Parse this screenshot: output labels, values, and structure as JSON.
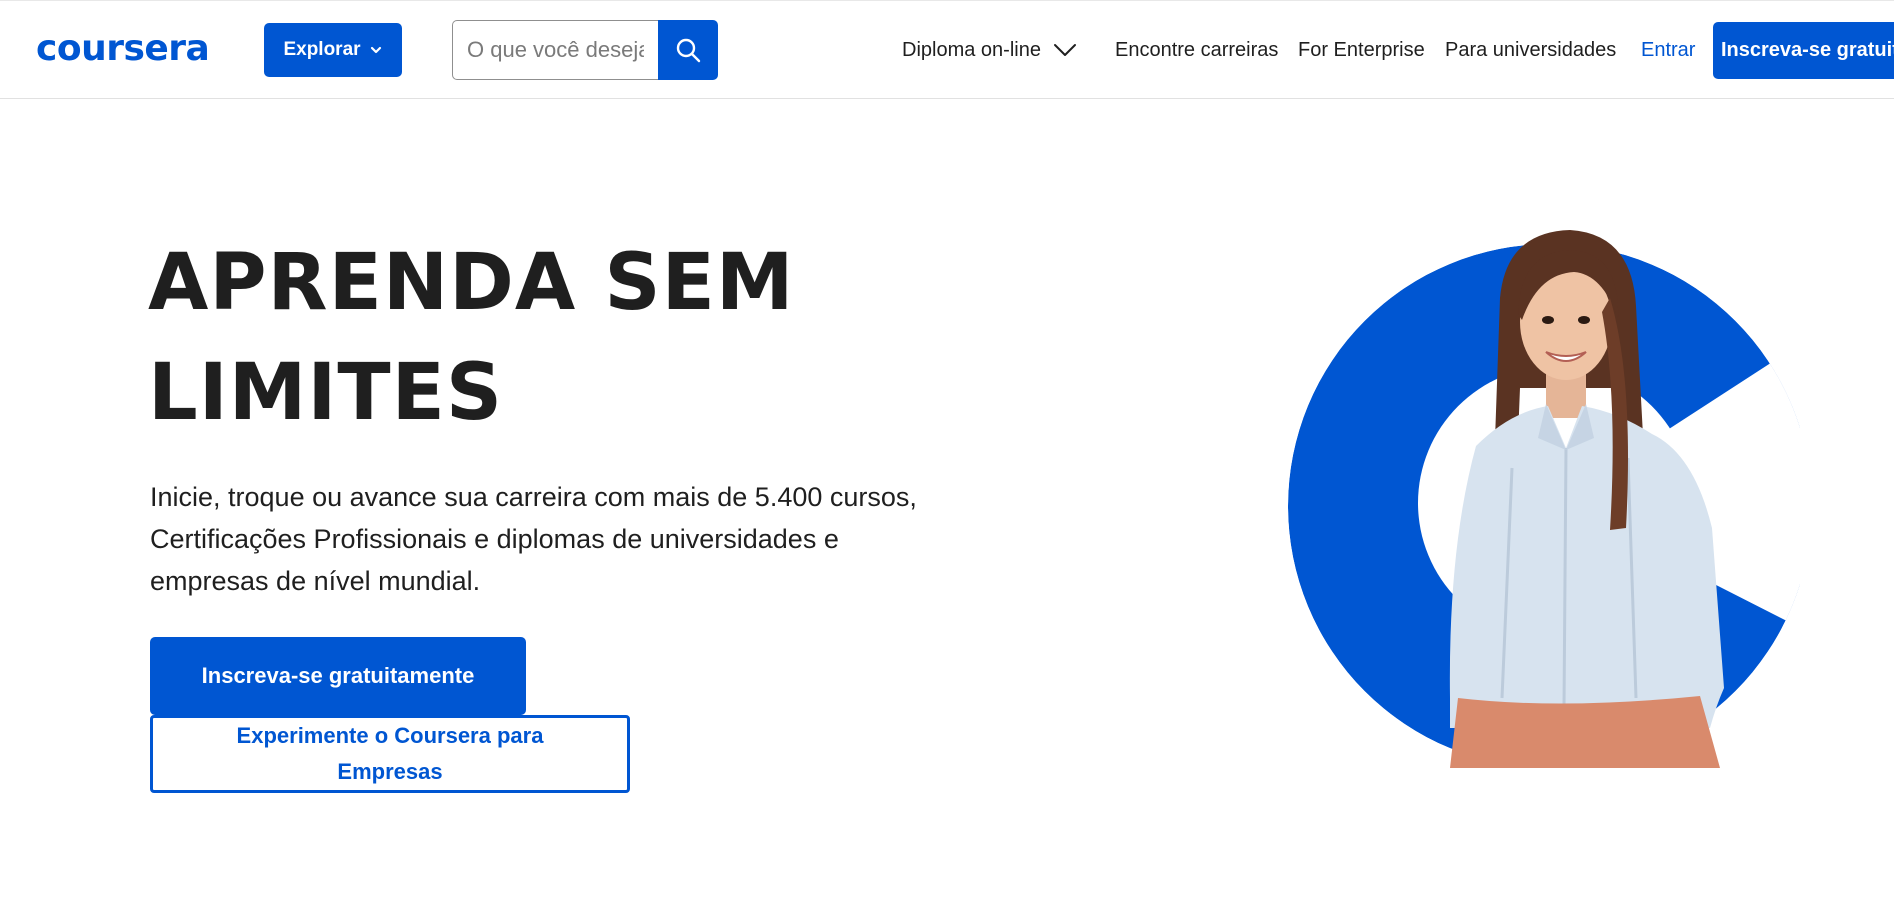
{
  "header": {
    "logo_text": "coursera",
    "explore_label": "Explorar",
    "search": {
      "placeholder": "O que você deseja aprender?",
      "value": ""
    },
    "nav": {
      "diploma": "Diploma on-line",
      "careers": "Encontre carreiras",
      "enterprise": "For Enterprise",
      "universities": "Para universidades",
      "login": "Entrar"
    },
    "signup_label": "Inscreva-se gratuitamente"
  },
  "hero": {
    "title_line1": "APRENDA SEM",
    "title_line2": "LIMITES",
    "subtitle": "Inicie, troque ou avance sua carreira com mais de 5.400 cursos, Certificações Profissionais e diplomas de universidades e empresas de nível mundial.",
    "cta_primary": "Inscreva-se gratuitamente",
    "cta_secondary": "Experimente o Coursera para Empresas"
  },
  "colors": {
    "brand": "#0056d2",
    "text": "#1f1f1f",
    "border": "#e1e1e1"
  },
  "icons": {
    "search": "search-icon",
    "explore_chevron": "chevron-down-icon",
    "diploma_chevron": "chevron-down-icon"
  }
}
